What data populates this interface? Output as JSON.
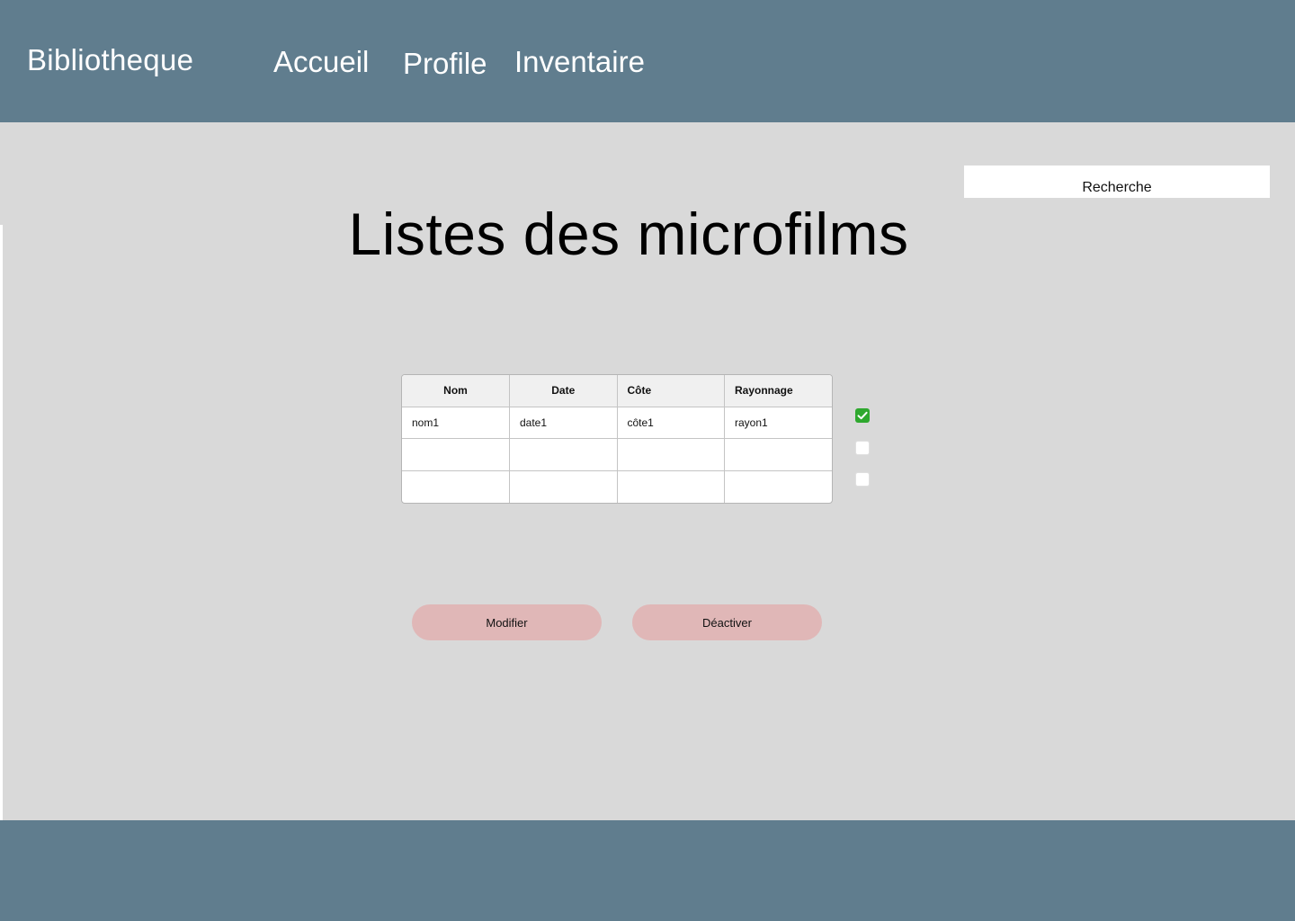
{
  "header": {
    "brand": "Bibliotheque",
    "nav": {
      "accueil": "Accueil",
      "profile": "Profile",
      "inventaire": "Inventaire"
    }
  },
  "search": {
    "placeholder": "Recherche"
  },
  "main": {
    "title": "Listes des microfilms"
  },
  "table": {
    "columns": [
      "Nom",
      "Date",
      "Côte",
      "Rayonnage"
    ],
    "rows": [
      [
        "nom1",
        "date1",
        "côte1",
        "rayon1"
      ],
      [
        "",
        "",
        "",
        ""
      ],
      [
        "",
        "",
        "",
        ""
      ]
    ],
    "row_checked": [
      true,
      false,
      false
    ]
  },
  "actions": {
    "modifier": "Modifier",
    "desactiver": "Déactiver"
  },
  "colors": {
    "header_bg": "#607d8e",
    "main_bg": "#d9d9d9",
    "button_bg": "#e0b7b7",
    "check_on": "#2ea82e"
  }
}
